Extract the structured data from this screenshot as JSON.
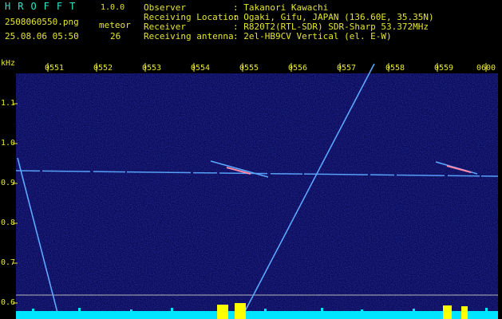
{
  "app": {
    "title": "HROFFT",
    "version": "1.0.0"
  },
  "file": {
    "name": "2508060550.png",
    "stamp": "25.08.06 05:50"
  },
  "meteor": {
    "label": "meteor",
    "count": "26"
  },
  "info": [
    {
      "key": "Observer",
      "value": ": Takanori Kawachi"
    },
    {
      "key": "Receiving Location",
      "value": ": Ogaki, Gifu, JAPAN (136.60E, 35.35N)"
    },
    {
      "key": "Receiver",
      "value": ": R820T2(RTL-SDR) SDR-Sharp 53.372MHz"
    },
    {
      "key": "Receiving antenna",
      "value": ": 2el-HB9CV Vertical (el. E-W)"
    }
  ],
  "axis": {
    "unit": "kHz",
    "y_ticks": [
      "1.1",
      "1.0",
      "0.9",
      "0.8",
      "0.7",
      "0.6"
    ],
    "time_ticks": [
      "0551",
      "0552",
      "0553",
      "0554",
      "0555",
      "0556",
      "0557",
      "0558",
      "0559",
      "0600"
    ]
  },
  "colors": {
    "background": "#000000",
    "waterfall": "#0a0a55",
    "trace": "#5aa8ff",
    "echo": "#ff88aa",
    "bars": "#00e5ff",
    "burst": "#ffff00",
    "text": "#e6e62e",
    "title": "#2ee6c8"
  }
}
